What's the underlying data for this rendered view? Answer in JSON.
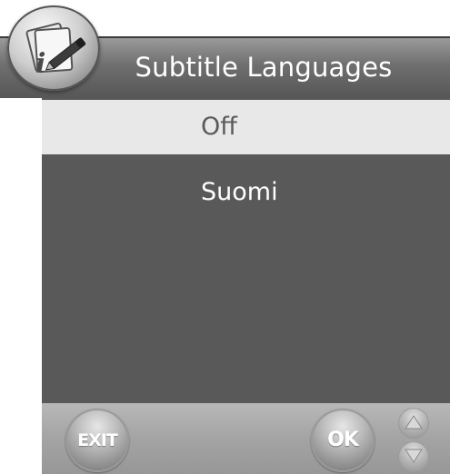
{
  "header": {
    "title": "Subtitle Languages",
    "icon": "info-edit-icon"
  },
  "menu": {
    "items": [
      {
        "label": "Off",
        "selected": true
      },
      {
        "label": "Suomi",
        "selected": false
      }
    ]
  },
  "footer": {
    "exit_label": "EXIT",
    "ok_label": "OK",
    "up_icon": "arrow-up-icon",
    "down_icon": "arrow-down-icon"
  },
  "colors": {
    "list_background": "#595959",
    "selected_background": "#e8e8e8",
    "title_bar": "#6f6f6f"
  }
}
